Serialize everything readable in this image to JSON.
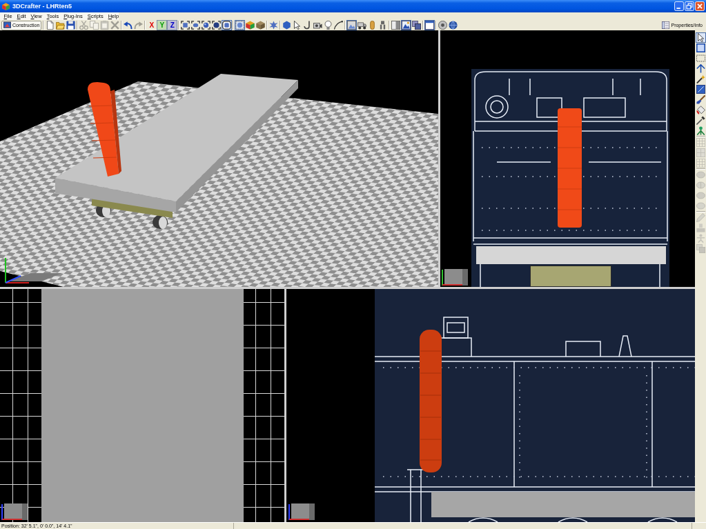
{
  "window": {
    "title": "3DCrafter - LHRten5"
  },
  "menu": [
    "File",
    "Edit",
    "View",
    "Tools",
    "Plug-Ins",
    "Scripts",
    "Help"
  ],
  "toolbar": {
    "mode_button": "Construction",
    "groups": [
      [
        {
          "kind": "icon",
          "disabled": false,
          "selected": false
        },
        {
          "kind": "icon",
          "disabled": false,
          "selected": false
        },
        {
          "kind": "icon",
          "disabled": false,
          "selected": false
        }
      ],
      [
        {
          "kind": "icon",
          "disabled": true,
          "selected": false
        },
        {
          "kind": "icon",
          "disabled": true,
          "selected": false
        },
        {
          "kind": "icon",
          "disabled": true,
          "selected": false
        },
        {
          "kind": "icon",
          "disabled": true,
          "selected": false
        }
      ],
      [
        {
          "kind": "icon",
          "disabled": false,
          "selected": false
        },
        {
          "kind": "icon",
          "disabled": true,
          "selected": false
        }
      ],
      [
        {
          "kind": "axis",
          "label": "X",
          "color": "#e00000",
          "disabled": false,
          "selected": false
        },
        {
          "kind": "axis",
          "label": "Y",
          "color": "#009a00",
          "disabled": false,
          "selected": true
        },
        {
          "kind": "axis",
          "label": "Z",
          "color": "#0000c8",
          "disabled": false,
          "selected": true
        }
      ],
      [
        {
          "kind": "icon",
          "disabled": false,
          "selected": false
        },
        {
          "kind": "icon",
          "disabled": false,
          "selected": false
        },
        {
          "kind": "icon",
          "disabled": false,
          "selected": false
        },
        {
          "kind": "icon",
          "disabled": false,
          "selected": false
        },
        {
          "kind": "icon",
          "disabled": false,
          "selected": true
        }
      ],
      [
        {
          "kind": "icon",
          "disabled": false,
          "selected": true
        },
        {
          "kind": "icon",
          "disabled": false,
          "selected": false
        },
        {
          "kind": "icon",
          "disabled": false,
          "selected": false
        }
      ],
      [
        {
          "kind": "icon",
          "disabled": false,
          "selected": false
        }
      ],
      [
        {
          "kind": "icon",
          "disabled": false,
          "selected": false
        },
        {
          "kind": "icon",
          "disabled": false,
          "selected": false
        },
        {
          "kind": "icon",
          "disabled": false,
          "selected": false
        },
        {
          "kind": "icon",
          "disabled": false,
          "selected": false
        },
        {
          "kind": "icon",
          "disabled": false,
          "selected": false
        },
        {
          "kind": "icon",
          "disabled": false,
          "selected": false
        }
      ],
      [
        {
          "kind": "icon",
          "disabled": false,
          "selected": true
        },
        {
          "kind": "icon",
          "disabled": false,
          "selected": false
        },
        {
          "kind": "icon",
          "disabled": false,
          "selected": false
        },
        {
          "kind": "icon",
          "disabled": false,
          "selected": false
        }
      ],
      [
        {
          "kind": "icon",
          "disabled": false,
          "selected": false
        },
        {
          "kind": "icon",
          "disabled": false,
          "selected": true
        },
        {
          "kind": "icon",
          "disabled": false,
          "selected": false
        }
      ],
      [
        {
          "kind": "icon",
          "disabled": false,
          "selected": true
        }
      ],
      [
        {
          "kind": "icon",
          "disabled": false,
          "selected": false
        },
        {
          "kind": "icon",
          "disabled": false,
          "selected": false
        }
      ]
    ],
    "properties_button": "Properties/Info"
  },
  "viewports": [
    {
      "kind": "perspective"
    },
    {
      "kind": "front"
    },
    {
      "kind": "top"
    },
    {
      "kind": "side"
    }
  ],
  "side_toolbar": [
    [
      {
        "disabled": false,
        "selected": true
      },
      {
        "disabled": false,
        "selected": false
      },
      {
        "disabled": false,
        "selected": false
      },
      {
        "disabled": false,
        "selected": false
      },
      {
        "disabled": false,
        "selected": false
      },
      {
        "disabled": false,
        "selected": false
      },
      {
        "disabled": false,
        "selected": false
      },
      {
        "disabled": false,
        "selected": false
      },
      {
        "disabled": false,
        "selected": false
      },
      {
        "disabled": false,
        "selected": false
      }
    ],
    [
      {
        "disabled": true,
        "selected": false
      },
      {
        "disabled": true,
        "selected": false
      },
      {
        "disabled": true,
        "selected": false
      }
    ],
    [
      {
        "disabled": true,
        "selected": false
      },
      {
        "disabled": true,
        "selected": false
      },
      {
        "disabled": true,
        "selected": false
      },
      {
        "disabled": true,
        "selected": false
      }
    ],
    [
      {
        "disabled": true,
        "selected": false
      },
      {
        "disabled": true,
        "selected": false
      },
      {
        "disabled": true,
        "selected": false
      },
      {
        "disabled": true,
        "selected": false
      }
    ]
  ],
  "status_bar": {
    "position": "Position: 32' 5.1\", 0' 0.0\", 14' 4.1\""
  }
}
